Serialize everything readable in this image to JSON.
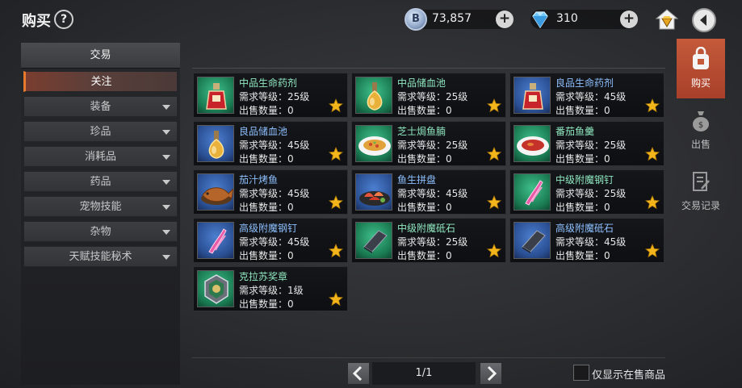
{
  "header": {
    "title": "购买",
    "help_label": "?"
  },
  "currency": {
    "coins": "73,857",
    "gems": "310",
    "coin_symbol": "B",
    "plus": "+"
  },
  "left_panel": {
    "header": "交易",
    "categories": [
      {
        "label": "关注",
        "active": true,
        "expand": false
      },
      {
        "label": "装备",
        "active": false,
        "expand": true
      },
      {
        "label": "珍品",
        "active": false,
        "expand": true
      },
      {
        "label": "消耗品",
        "active": false,
        "expand": true
      },
      {
        "label": "药品",
        "active": false,
        "expand": true
      },
      {
        "label": "宠物技能",
        "active": false,
        "expand": true
      },
      {
        "label": "杂物",
        "active": false,
        "expand": true
      },
      {
        "label": "天赋技能秘术",
        "active": false,
        "expand": true
      }
    ]
  },
  "items": [
    {
      "name": "中品生命药剂",
      "level": "需求等级：25级",
      "count": "出售数量：0",
      "bg": "green",
      "icon": "red-potion-icon"
    },
    {
      "name": "中品储血池",
      "level": "需求等级：25级",
      "count": "出售数量：0",
      "bg": "green",
      "icon": "yellow-potion-icon"
    },
    {
      "name": "良品生命药剂",
      "level": "需求等级：45级",
      "count": "出售数量：0",
      "bg": "blue",
      "icon": "red-potion-icon"
    },
    {
      "name": "良品储血池",
      "level": "需求等级：45级",
      "count": "出售数量：0",
      "bg": "blue",
      "icon": "yellow-potion-icon"
    },
    {
      "name": "芝士焗鱼腩",
      "level": "需求等级：25级",
      "count": "出售数量：0",
      "bg": "green",
      "icon": "fish-dish-icon"
    },
    {
      "name": "番茄鱼羹",
      "level": "需求等级：25级",
      "count": "出售数量：0",
      "bg": "green",
      "icon": "soup-dish-icon"
    },
    {
      "name": "茄汁烤鱼",
      "level": "需求等级：45级",
      "count": "出售数量：0",
      "bg": "blue",
      "icon": "grilled-fish-icon"
    },
    {
      "name": "鱼生拼盘",
      "level": "需求等级：45级",
      "count": "出售数量：0",
      "bg": "blue",
      "icon": "sashimi-icon"
    },
    {
      "name": "中级附魔钢钉",
      "level": "需求等级：25级",
      "count": "出售数量：0",
      "bg": "green",
      "icon": "steel-nail-icon"
    },
    {
      "name": "高级附魔钢钉",
      "level": "需求等级：45级",
      "count": "出售数量：0",
      "bg": "blue",
      "icon": "steel-nail-icon"
    },
    {
      "name": "中级附魔砥石",
      "level": "需求等级：25级",
      "count": "出售数量：0",
      "bg": "green",
      "icon": "whetstone-icon"
    },
    {
      "name": "高级附魔砥石",
      "level": "需求等级：45级",
      "count": "出售数量：0",
      "bg": "blue",
      "icon": "whetstone-icon"
    },
    {
      "name": "克拉苏奖章",
      "level": "需求等级：1级",
      "count": "出售数量：0",
      "bg": "green",
      "icon": "medal-icon"
    }
  ],
  "pagination": {
    "page": "1/1"
  },
  "filter": {
    "on_sale_only_label": "仅显示在售商品",
    "checked": false
  },
  "side_tabs": [
    {
      "label": "购买",
      "active": true,
      "icon": "bag-icon"
    },
    {
      "label": "出售",
      "active": false,
      "icon": "money-bag-icon"
    },
    {
      "label": "交易记录",
      "active": false,
      "icon": "record-icon"
    }
  ],
  "colors": {
    "accent": "#c45a3a",
    "green_name": "#8fe8c0",
    "blue_name": "#8dc0ff",
    "star": "#f2b51c"
  }
}
